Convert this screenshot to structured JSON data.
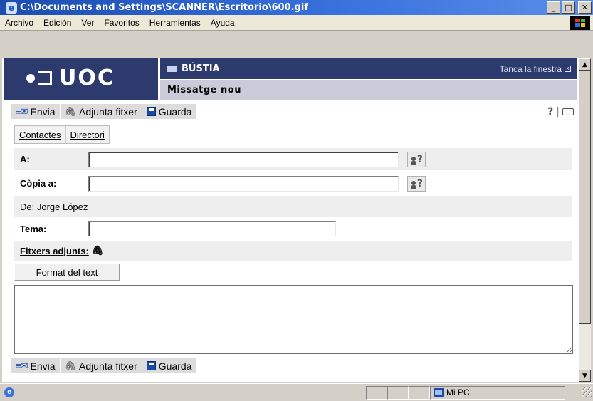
{
  "window": {
    "title": "C:\\Documents and Settings\\SCANNER\\Escritorio\\600.gif",
    "icon": "ie-icon"
  },
  "menu": [
    "Archivo",
    "Edición",
    "Ver",
    "Favoritos",
    "Herramientas",
    "Ayuda"
  ],
  "header": {
    "logo": "UOC",
    "section": "BÚSTIA",
    "close_window": "Tanca la finestra",
    "subtitle": "Missatge nou"
  },
  "toolbar": {
    "send": "Envia",
    "attach": "Adjunta fitxer",
    "save": "Guarda"
  },
  "tabs": [
    "Contactes",
    "Directori"
  ],
  "form": {
    "to_label": "A:",
    "to_value": "",
    "cc_label": "Còpia a:",
    "cc_value": "",
    "from_text": "De: Jorge López",
    "subject_label": "Tema:",
    "subject_value": "",
    "attachments_label": "Fitxers adjunts:",
    "format_button": "Format del text",
    "body": ""
  },
  "statusbar": {
    "zone": "Mi PC"
  },
  "colors": {
    "uoc_navy": "#2d3a6e",
    "subheader": "#c9ccd8",
    "title_blue": "#1c4db0"
  }
}
